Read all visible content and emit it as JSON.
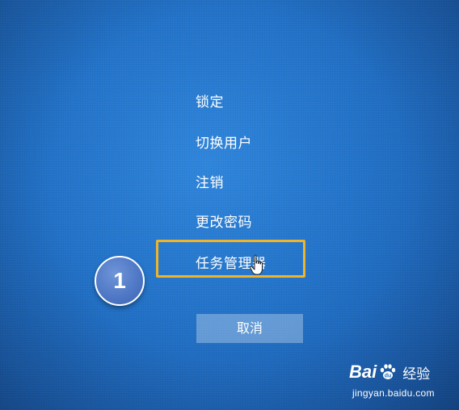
{
  "menu": {
    "items": [
      {
        "label": "锁定"
      },
      {
        "label": "切换用户"
      },
      {
        "label": "注销"
      },
      {
        "label": "更改密码"
      },
      {
        "label": "任务管理器"
      }
    ]
  },
  "cancel_label": "取消",
  "annotation": {
    "step_number": "1",
    "highlight_color": "#f0b428"
  },
  "watermark": {
    "brand_left": "Bai",
    "brand_right": "du",
    "brand_icon": "paw-icon",
    "product": "经验",
    "url": "jingyan.baidu.com"
  },
  "colors": {
    "background": "#2272c8",
    "text": "#ffffff",
    "badge": "#4d76c4"
  }
}
